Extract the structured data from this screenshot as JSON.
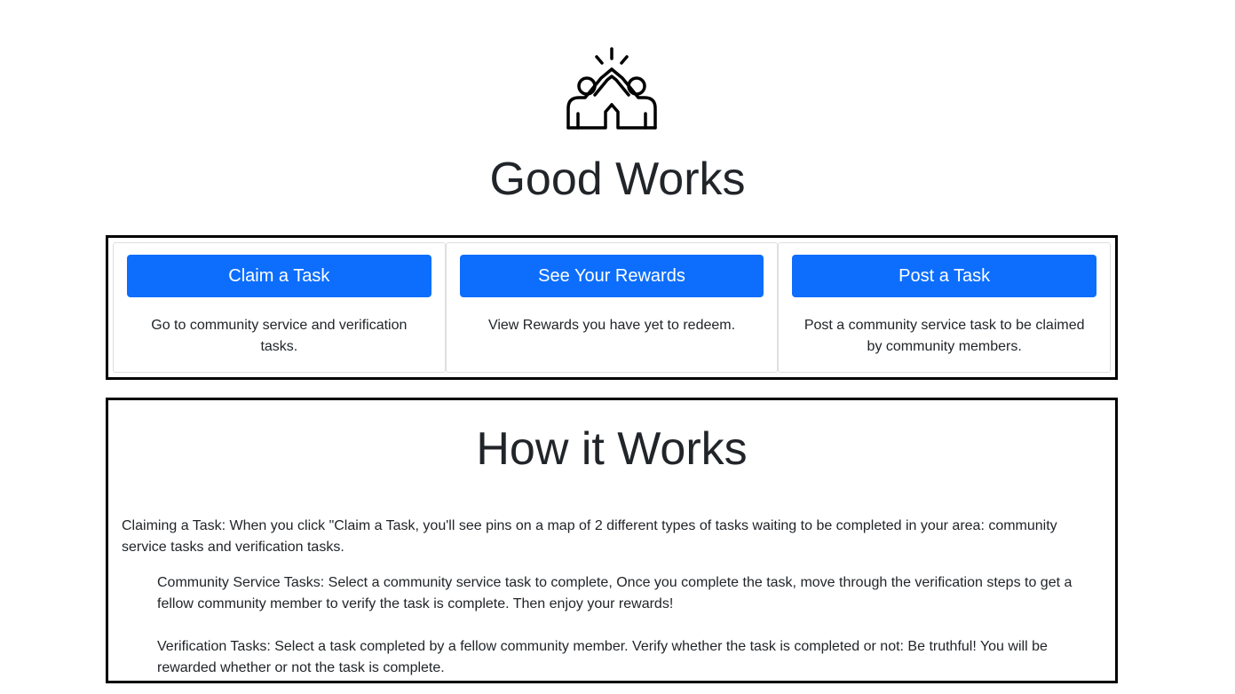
{
  "header": {
    "logo_icon": "high-five-icon",
    "title": "Good Works"
  },
  "actions": [
    {
      "button_label": "Claim a Task",
      "description": "Go to community service and verification tasks."
    },
    {
      "button_label": "See Your Rewards",
      "description": "View Rewards you have yet to redeem."
    },
    {
      "button_label": "Post a Task",
      "description": "Post a community service task to be claimed by community members."
    }
  ],
  "how_it_works": {
    "title": "How it Works",
    "intro": "Claiming a Task: When you click \"Claim a Task, you'll see pins on a map of 2 different types of tasks waiting to be completed in your area: community service tasks and verification tasks.",
    "community_service": "Community Service Tasks: Select a community service task to complete, Once you complete the task, move through the verification steps to get a fellow community member to verify the task is complete. Then enjoy your rewards!",
    "verification": "Verification Tasks: Select a task completed by a fellow community member. Verify whether the task is completed or not: Be truthful! You will be rewarded whether or not the task is complete."
  },
  "colors": {
    "button": "#0d6efd",
    "text": "#212529",
    "border": "#000000"
  }
}
